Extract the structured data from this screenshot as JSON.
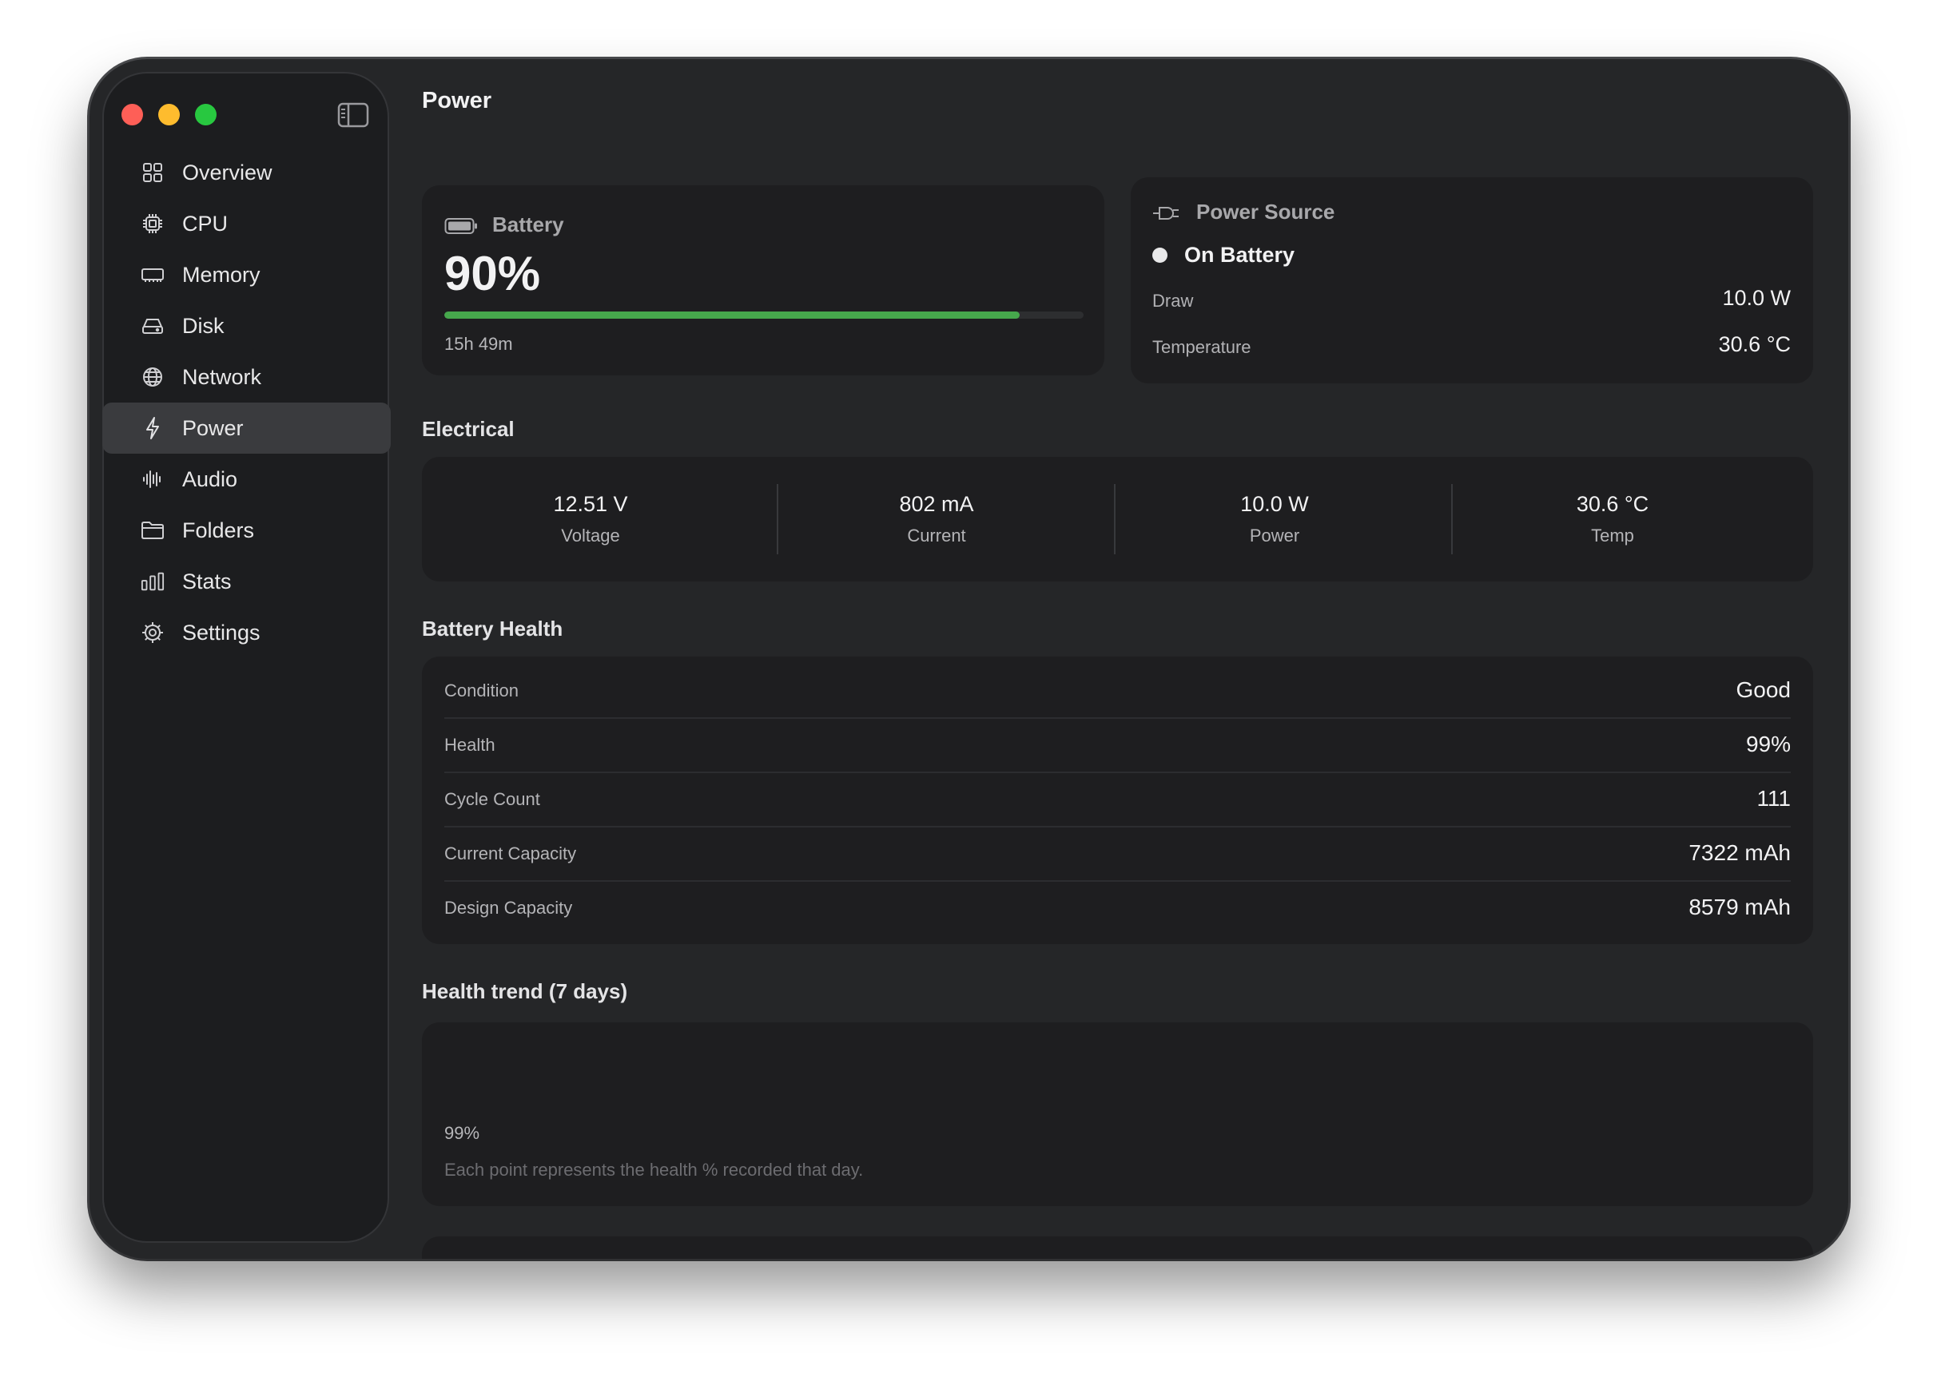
{
  "window": {
    "controls": [
      "close",
      "minimize",
      "zoom"
    ],
    "sidebar_toggle_icon": "sidebar-icon"
  },
  "sidebar": {
    "items": [
      {
        "label": "Overview",
        "icon": "grid-icon",
        "active": false
      },
      {
        "label": "CPU",
        "icon": "cpu-icon",
        "active": false
      },
      {
        "label": "Memory",
        "icon": "memory-icon",
        "active": false
      },
      {
        "label": "Disk",
        "icon": "disk-icon",
        "active": false
      },
      {
        "label": "Network",
        "icon": "globe-icon",
        "active": false
      },
      {
        "label": "Power",
        "icon": "bolt-icon",
        "active": true
      },
      {
        "label": "Audio",
        "icon": "waveform-icon",
        "active": false
      },
      {
        "label": "Folders",
        "icon": "folder-icon",
        "active": false
      },
      {
        "label": "Stats",
        "icon": "chart-bars-icon",
        "active": false
      },
      {
        "label": "Settings",
        "icon": "gear-icon",
        "active": false
      }
    ]
  },
  "main": {
    "title": "Power",
    "battery": {
      "title": "Battery",
      "percent_label": "90%",
      "level": 0.9,
      "time_remaining": "15h 49m",
      "bar_color": "#46a74c"
    },
    "power_source": {
      "title": "Power Source",
      "status": "On Battery",
      "draw_label": "Draw",
      "draw_value": "10.0 W",
      "temp_label": "Temperature",
      "temp_value": "30.6 °C"
    },
    "electrical": {
      "title": "Electrical",
      "metrics": [
        {
          "value": "12.51 V",
          "label": "Voltage"
        },
        {
          "value": "802 mA",
          "label": "Current"
        },
        {
          "value": "10.0 W",
          "label": "Power"
        },
        {
          "value": "30.6 °C",
          "label": "Temp"
        }
      ]
    },
    "health": {
      "title": "Battery Health",
      "rows": [
        {
          "label": "Condition",
          "value": "Good"
        },
        {
          "label": "Health",
          "value": "99%"
        },
        {
          "label": "Cycle Count",
          "value": "111"
        },
        {
          "label": "Current Capacity",
          "value": "7322 mAh"
        },
        {
          "label": "Design Capacity",
          "value": "8579 mAh"
        }
      ]
    },
    "trend": {
      "title": "Health trend (7 days)",
      "value": "99%",
      "note": "Each point represents the health % recorded that day."
    }
  }
}
